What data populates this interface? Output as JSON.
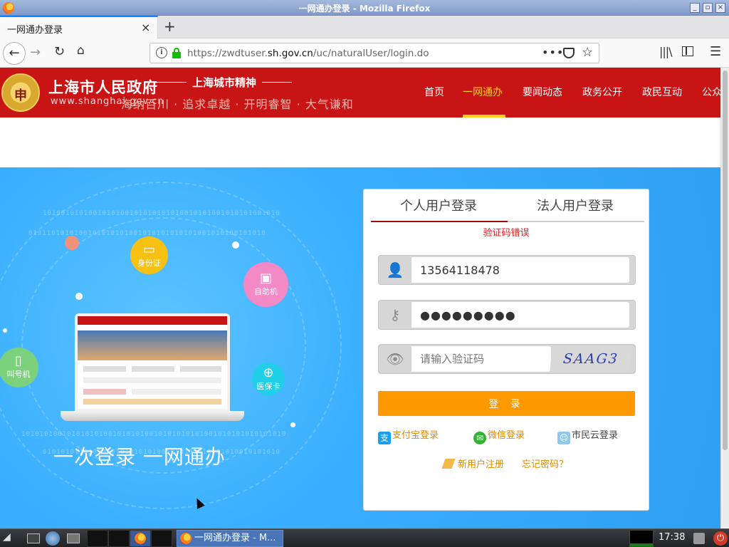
{
  "window": {
    "title": "一网通办登录 - Mozilla Firefox"
  },
  "browser": {
    "tab_title": "一网通办登录",
    "tab_close": "×",
    "new_tab": "+",
    "url_prefix": "https://zwdtuser.",
    "url_domain": "sh.gov.cn",
    "url_path": "/uc/naturalUser/login.do",
    "page_actions": "•••"
  },
  "site": {
    "emblem_text": "申",
    "name": "上海市人民政府",
    "url": "www.shanghai.gov.cn",
    "spirit_title": "上海城市精神",
    "spirit_text": "海纳百川 · 追求卓越 · 开明睿智 · 大气谦和",
    "nav": [
      "首页",
      "一网通办",
      "要闻动态",
      "政务公开",
      "政民互动",
      "公众"
    ],
    "active_nav": "一网通办"
  },
  "hero": {
    "features": [
      "身份证",
      "自助机",
      "叫号机",
      "医保卡"
    ],
    "slogan": "一次登录  一网通办"
  },
  "login": {
    "tabs": [
      "个人用户登录",
      "法人用户登录"
    ],
    "error": "验证码错误",
    "username": "13564118478",
    "password": "●●●●●●●●●",
    "captcha_placeholder": "请输入验证码",
    "captcha_image_text": "SAAG3",
    "submit_label": "登 录",
    "alt_logins": [
      "支付宝登录",
      "微信登录",
      "市民云登录"
    ],
    "register": "新用户注册",
    "forgot": "忘记密码？"
  },
  "taskbar": {
    "task_label": "一网通办登录 - M...",
    "clock": "17:38"
  },
  "colors": {
    "header_red": "#c81414",
    "nav_active": "#ffd21f",
    "hero_blue": "#3aafff",
    "login_button": "#fe9a00",
    "error_red": "#e02020"
  }
}
